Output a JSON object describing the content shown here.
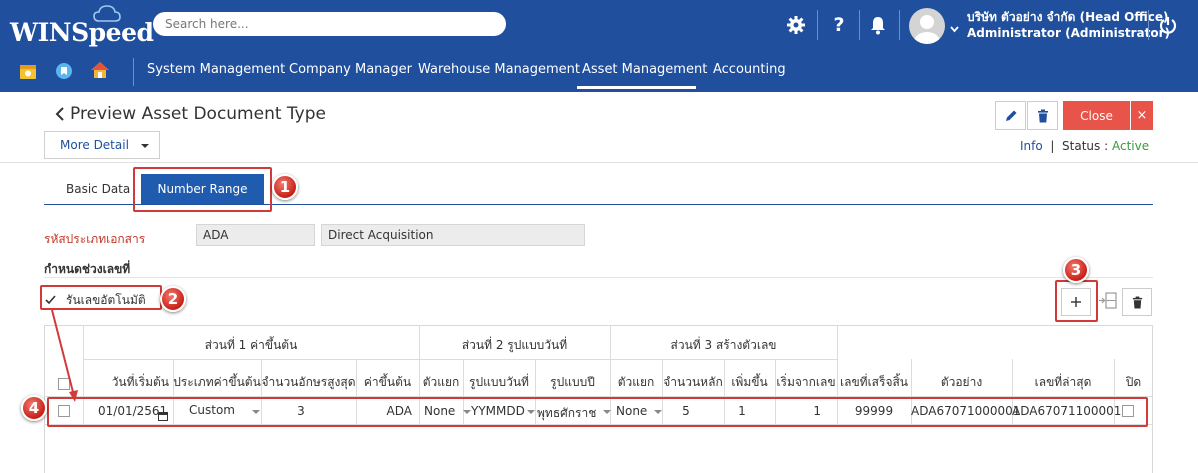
{
  "header": {
    "logo": "WINSpeed",
    "search_placeholder": "Search here...",
    "company": "บริษัท ตัวอย่าง จำกัด (Head Office)",
    "user": "Administrator (Administrator)",
    "icons": [
      "gear-icon",
      "help-icon",
      "bell-icon",
      "avatar",
      "chevron-down-icon",
      "power-icon"
    ]
  },
  "nav": {
    "quick_icons": [
      "calendar-icon",
      "bookmark-icon",
      "home-icon"
    ],
    "items": [
      "System Management",
      "Company Manager",
      "Warehouse Management",
      "Asset Management",
      "Accounting"
    ],
    "active": "Asset Management"
  },
  "page": {
    "title": "Preview Asset Document Type",
    "more_detail": "More Detail",
    "close_label": "Close",
    "close_x": "×",
    "info": "Info",
    "status_label": "Status",
    "status_sep": ":",
    "status_value": "Active"
  },
  "tabs": {
    "basic": "Basic Data",
    "number_range": "Number Range"
  },
  "form": {
    "doc_type_label": "รหัสประเภทเอกสาร",
    "doc_code": "ADA",
    "doc_name": "Direct Acquisition",
    "range_label": "กำหนดช่วงเลขที่",
    "auto_label": "รันเลขอัตโนมัติ",
    "auto_checked": true
  },
  "annotations": [
    "1",
    "2",
    "3",
    "4"
  ],
  "table": {
    "groups": [
      "ส่วนที่ 1 ค่าขึ้นต้น",
      "ส่วนที่ 2 รูปแบบวันที่",
      "ส่วนที่ 3 สร้างตัวเลข"
    ],
    "columns": [
      "วันที่เริ่มต้น",
      "ประเภทค่าขึ้นต้น",
      "จำนวนอักษรสูงสุด",
      "ค่าขึ้นต้น",
      "ตัวแยก",
      "รูปแบบวันที่",
      "รูปแบบปี",
      "ตัวแยก",
      "จำนวนหลัก",
      "เพิ่มขึ้น",
      "เริ่มจากเลข",
      "เลขที่เสร็จสิ้น",
      "ตัวอย่าง",
      "เลขที่ล่าสุด",
      "ปิด"
    ],
    "row": {
      "start_date": "01/01/2561",
      "prefix_type": "Custom",
      "max_chars": "3",
      "prefix": "ADA",
      "separator1": "None",
      "date_format": "YYMMDD",
      "year_format": "พุทธศักราช",
      "separator2": "None",
      "digits": "5",
      "increment": "1",
      "start_from": "1",
      "end_no": "99999",
      "example": "ADA67071000001",
      "last_no": "ADA67071100001",
      "closed": false
    }
  },
  "colors": {
    "header_bg": "#1f4f9d",
    "tab_active": "#1f5cb0",
    "close_btn": "#e8534a",
    "annotation": "#d23a3a",
    "status_active": "#3a9a3a"
  }
}
